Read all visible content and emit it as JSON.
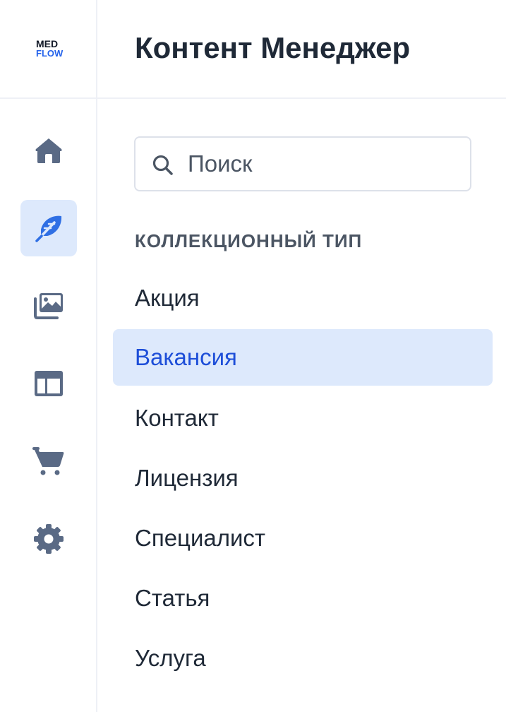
{
  "app": {
    "logo_line1": "MED",
    "logo_line2": "FLOW"
  },
  "header": {
    "title": "Контент Менеджер"
  },
  "rail": {
    "items": [
      {
        "icon": "home-icon",
        "active": false
      },
      {
        "icon": "feather-icon",
        "active": true
      },
      {
        "icon": "media-library-icon",
        "active": false
      },
      {
        "icon": "layout-icon",
        "active": false
      },
      {
        "icon": "cart-icon",
        "active": false
      },
      {
        "icon": "gear-icon",
        "active": false
      }
    ]
  },
  "search": {
    "placeholder": "Поиск",
    "value": ""
  },
  "collection": {
    "label": "КОЛЛЕКЦИОННЫЙ ТИП",
    "items": [
      {
        "label": "Акция",
        "active": false
      },
      {
        "label": "Вакансия",
        "active": true
      },
      {
        "label": "Контакт",
        "active": false
      },
      {
        "label": "Лицензия",
        "active": false
      },
      {
        "label": "Специалист",
        "active": false
      },
      {
        "label": "Статья",
        "active": false
      },
      {
        "label": "Услуга",
        "active": false
      }
    ]
  },
  "colors": {
    "accent": "#1d4ed8",
    "active_bg": "#dde9fc",
    "icon": "#5a6a85",
    "text": "#1f2937"
  }
}
